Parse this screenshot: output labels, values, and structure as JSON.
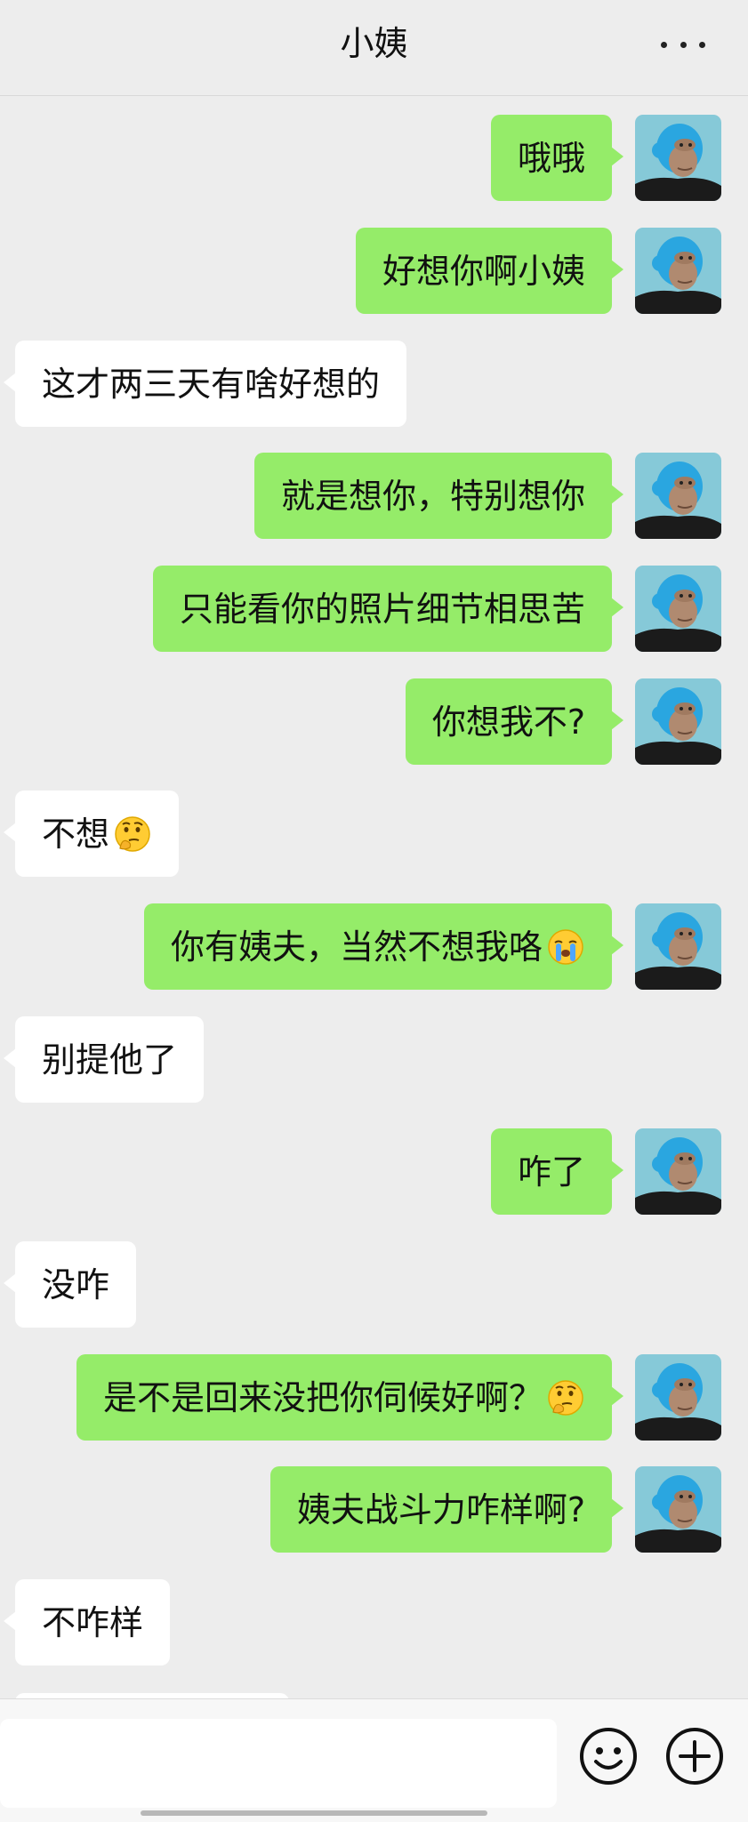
{
  "header": {
    "title": "小姨",
    "more_icon": "more-dots-icon"
  },
  "messages": [
    {
      "side": "me",
      "text": "哦哦"
    },
    {
      "side": "me",
      "text": "好想你啊小姨"
    },
    {
      "side": "them",
      "text": "这才两三天有啥好想的"
    },
    {
      "side": "me",
      "text": "就是想你，特别想你"
    },
    {
      "side": "me",
      "text": "只能看你的照片细节相思苦"
    },
    {
      "side": "me",
      "text": "你想我不?"
    },
    {
      "side": "them",
      "text": "不想",
      "emoji": "thinking-face"
    },
    {
      "side": "me",
      "text": "你有姨夫，当然不想我咯",
      "emoji": "crying-face"
    },
    {
      "side": "them",
      "text": "别提他了"
    },
    {
      "side": "me",
      "text": "咋了"
    },
    {
      "side": "them",
      "text": "没咋"
    },
    {
      "side": "me",
      "text": "是不是回来没把你伺候好啊？",
      "emoji": "thinking-face"
    },
    {
      "side": "me",
      "text": "姨夫战斗力咋样啊?"
    },
    {
      "side": "them",
      "text": "不咋样"
    }
  ],
  "input": {
    "value": "",
    "emoji_icon": "smiley-icon",
    "plus_icon": "plus-circle-icon"
  },
  "colors": {
    "me_bubble": "#95ec69",
    "them_bubble": "#ffffff",
    "background": "#ededed"
  }
}
